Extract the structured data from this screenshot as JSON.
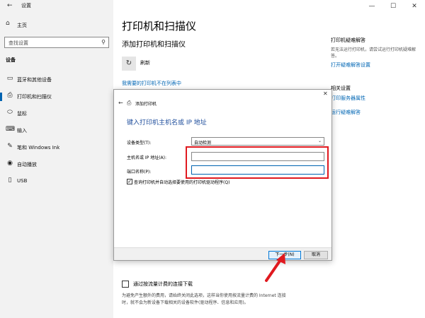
{
  "window": {
    "title": "设置",
    "minimize": "—",
    "maximize": "☐",
    "close": "✕"
  },
  "sidebar": {
    "home_label": "主页",
    "search_placeholder": "查找设置",
    "section_label": "设备",
    "items": [
      {
        "label": "蓝牙和其他设备",
        "icon": "bluetooth-device-icon"
      },
      {
        "label": "打印机和扫描仪",
        "icon": "printer-icon"
      },
      {
        "label": "鼠标",
        "icon": "mouse-icon"
      },
      {
        "label": "输入",
        "icon": "keyboard-icon"
      },
      {
        "label": "笔和 Windows Ink",
        "icon": "pen-icon"
      },
      {
        "label": "自动播放",
        "icon": "autoplay-icon"
      },
      {
        "label": "USB",
        "icon": "usb-icon"
      }
    ]
  },
  "main": {
    "title": "打印机和扫描仪",
    "subtitle": "添加打印机和扫描仪",
    "refresh_label": "刷新",
    "not_listed_link": "我需要的打印机不在列表中",
    "metered_label": "通过按流量计费的连接下载",
    "metered_desc": "为避免产生额外的费用，请始终关闭此选项，这样当你使用按流量计费的 Internet 连接时，就不会为新设备下载相关的设备软件(驱动程序、信息和应用)。"
  },
  "right_panel": {
    "troubleshoot_heading": "打印机疑难解答",
    "troubleshoot_text": "若无法运行打印机，请尝试运行打印机疑难解答。",
    "troubleshoot_link": "打开疑难解答设置",
    "related_heading": "相关设置",
    "related_links": [
      "打印服务器属性",
      "运行疑难解答"
    ]
  },
  "dialog": {
    "title": "添加打印机",
    "heading": "键入打印机主机名或 IP 地址",
    "device_type_label": "设备类型(T):",
    "device_type_value": "自动检测",
    "hostname_label": "主机名或 IP 地址(A):",
    "port_label": "端口名称(P):",
    "hostname_value": "",
    "port_value": "",
    "checkbox_label": "查询打印机并自动选择要使用的打印机驱动程序(Q)",
    "checkbox_checked": true,
    "next_button": "下一步(N)",
    "cancel_button": "取消"
  },
  "annotations": {
    "highlight_color": "#e0191f",
    "arrow_color": "#e0191f"
  }
}
